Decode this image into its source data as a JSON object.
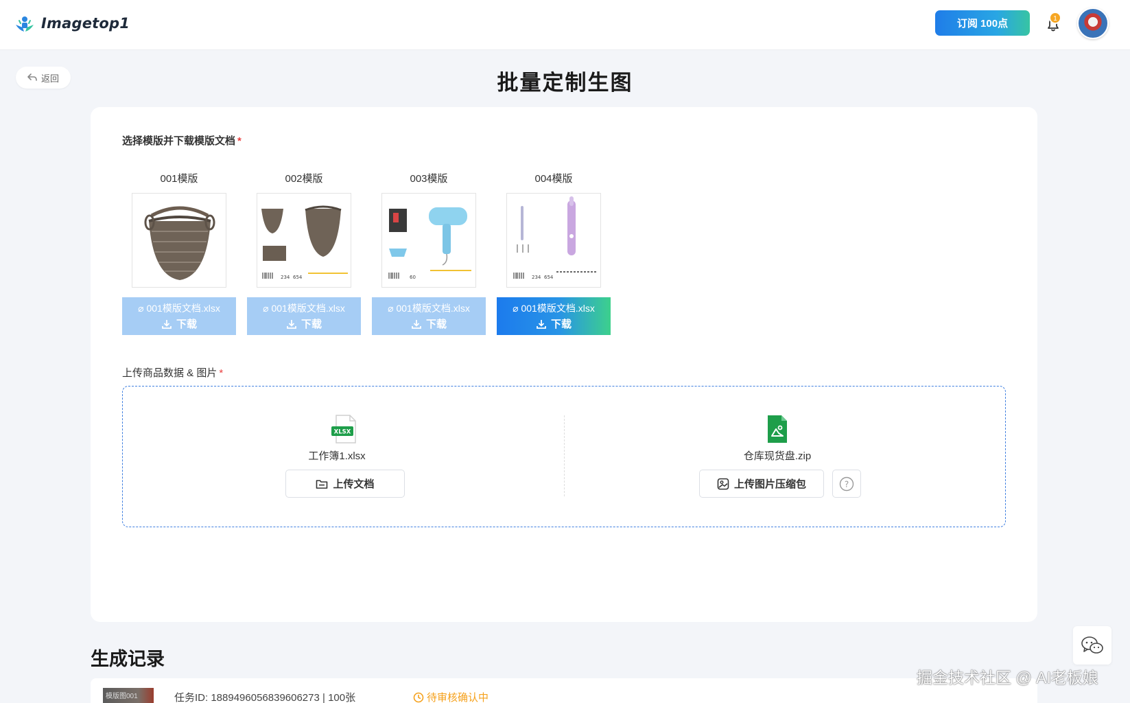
{
  "app": {
    "name": "Imagetop1"
  },
  "header": {
    "subscribe_label": "订阅 100点",
    "notification_count": "1"
  },
  "nav": {
    "back_label": "返回"
  },
  "page": {
    "title": "批量定制生图"
  },
  "template_section": {
    "label": "选择模版并下载模版文档",
    "required_mark": "*",
    "templates": [
      {
        "name": "001模版",
        "file": "001模版文档.xlsx",
        "download_label": "下载",
        "selected": false
      },
      {
        "name": "002模版",
        "file": "001模版文档.xlsx",
        "download_label": "下载",
        "selected": false
      },
      {
        "name": "003模版",
        "file": "001模版文档.xlsx",
        "download_label": "下载",
        "selected": false
      },
      {
        "name": "004模版",
        "file": "001模版文档.xlsx",
        "download_label": "下载",
        "selected": true
      }
    ]
  },
  "upload_section": {
    "label": "上传商品数据 & 图片",
    "required_mark": "*",
    "document": {
      "icon_text": "XLSX",
      "file_name": "工作簿1.xlsx",
      "button_label": "上传文档"
    },
    "images": {
      "file_name": "仓库现货盘.zip",
      "button_label": "上传图片压缩包",
      "help_glyph": "?"
    }
  },
  "history": {
    "title": "生成记录",
    "records": [
      {
        "thumb_label": "模版图001",
        "task_text": "任务ID: 1889496056839606273  |  100张",
        "status": "待审核确认中"
      }
    ]
  },
  "watermark": "掘金技术社区 @ AI老板娘",
  "colors": {
    "primary_blue": "#1f7de8",
    "accent_green": "#3dd08c",
    "disabled_blue": "#a6cdf5",
    "required_red": "#e94141",
    "pending_orange": "#f5a11c",
    "excel_green": "#1e9e4a"
  }
}
